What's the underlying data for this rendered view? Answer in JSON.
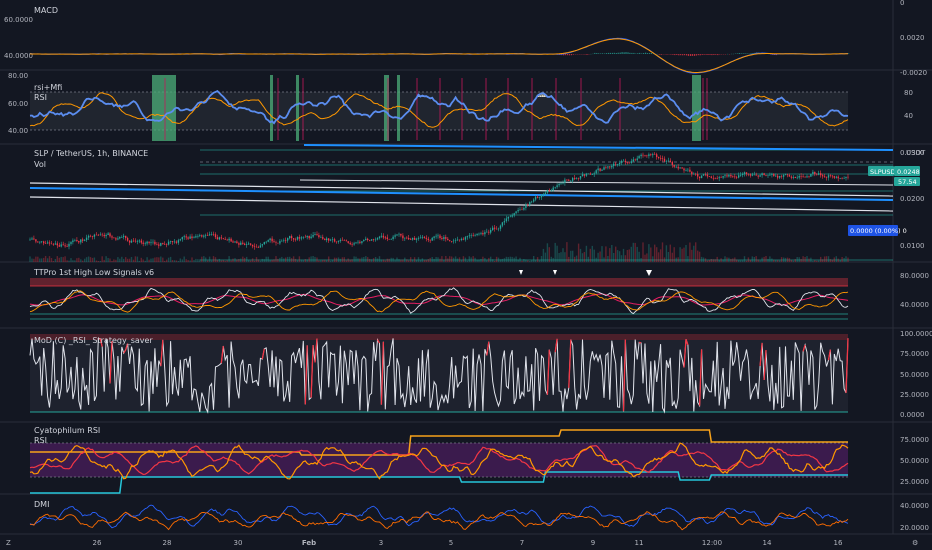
{
  "chart_data": {
    "type": "line",
    "symbol_title": "SLP / TetherUS, 1h, BINANCE",
    "volume_label": "Vol",
    "currency": "USDT",
    "x_ticks": [
      "26",
      "28",
      "30",
      "Feb",
      "3",
      "5",
      "7",
      "9",
      "11",
      "12:00",
      "14",
      "16"
    ],
    "panes": {
      "macd": {
        "title": "MACD",
        "left_ticks": [
          "60.0000",
          "40.0000"
        ],
        "right_ticks": [
          "0.0020",
          "-0.0020"
        ]
      },
      "rsi_mfi": {
        "title": "rsi+Mfi",
        "subtitle": "RSI",
        "left_ticks": [
          "80.00",
          "60.00",
          "40.00"
        ],
        "right_ticks": [
          "80",
          "40"
        ]
      },
      "price": {
        "right_ticks": [
          "0.0300",
          "0.0200",
          "0.0100"
        ],
        "price_badge_1": "SLPUSDT",
        "price_badge_1b": "0.0248",
        "price_badge_2": "57.54",
        "price_badge_3": "0.0000 (0.00%) 0"
      },
      "ttpro": {
        "title": "TTPro 1st High Low Signals v6",
        "right_ticks": [
          "80.0000",
          "40.0000"
        ]
      },
      "mod_rsi": {
        "title": "MoD (C) _RSI_ Strategy_saver",
        "right_ticks": [
          "100.0000",
          "75.0000",
          "50.0000",
          "25.0000",
          "0.0000"
        ]
      },
      "cyato": {
        "title": "Cyatophilum RSI",
        "subtitle": "RSI",
        "right_ticks": [
          "75.0000",
          "50.0000",
          "25.0000"
        ]
      },
      "dmi": {
        "title": "DMI",
        "right_ticks": [
          "40.0000",
          "20.0000"
        ]
      }
    },
    "colors": {
      "background": "#131722",
      "grid": "#1e222d",
      "orange": "#ff9800",
      "blue": "#5b8def",
      "white": "#e0e3eb",
      "red": "#f23645",
      "green": "#26a69a",
      "teal_block": "#4caf7a",
      "purple": "#4a1e5c",
      "cyan": "#26c6da",
      "yellow_line": "#f7a21b"
    },
    "generator_seed": 7
  },
  "corner_left": "Z",
  "corner_right": "⚙"
}
